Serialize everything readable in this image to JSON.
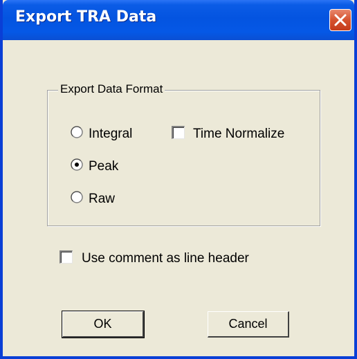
{
  "window": {
    "title": "Export TRA Data"
  },
  "export_format": {
    "legend": "Export Data Format",
    "options": [
      {
        "label": "Integral",
        "selected": false
      },
      {
        "label": "Peak",
        "selected": true
      },
      {
        "label": "Raw",
        "selected": false
      }
    ],
    "time_normalize": {
      "label": "Time Normalize",
      "checked": false
    }
  },
  "line_header": {
    "label": "Use comment as line header",
    "checked": false
  },
  "buttons": {
    "ok": "OK",
    "cancel": "Cancel"
  },
  "icons": {
    "close": "close-icon"
  },
  "colors": {
    "titlebar": "#0454e0",
    "close_button": "#d5522f",
    "dialog_background": "#ece9d8"
  }
}
